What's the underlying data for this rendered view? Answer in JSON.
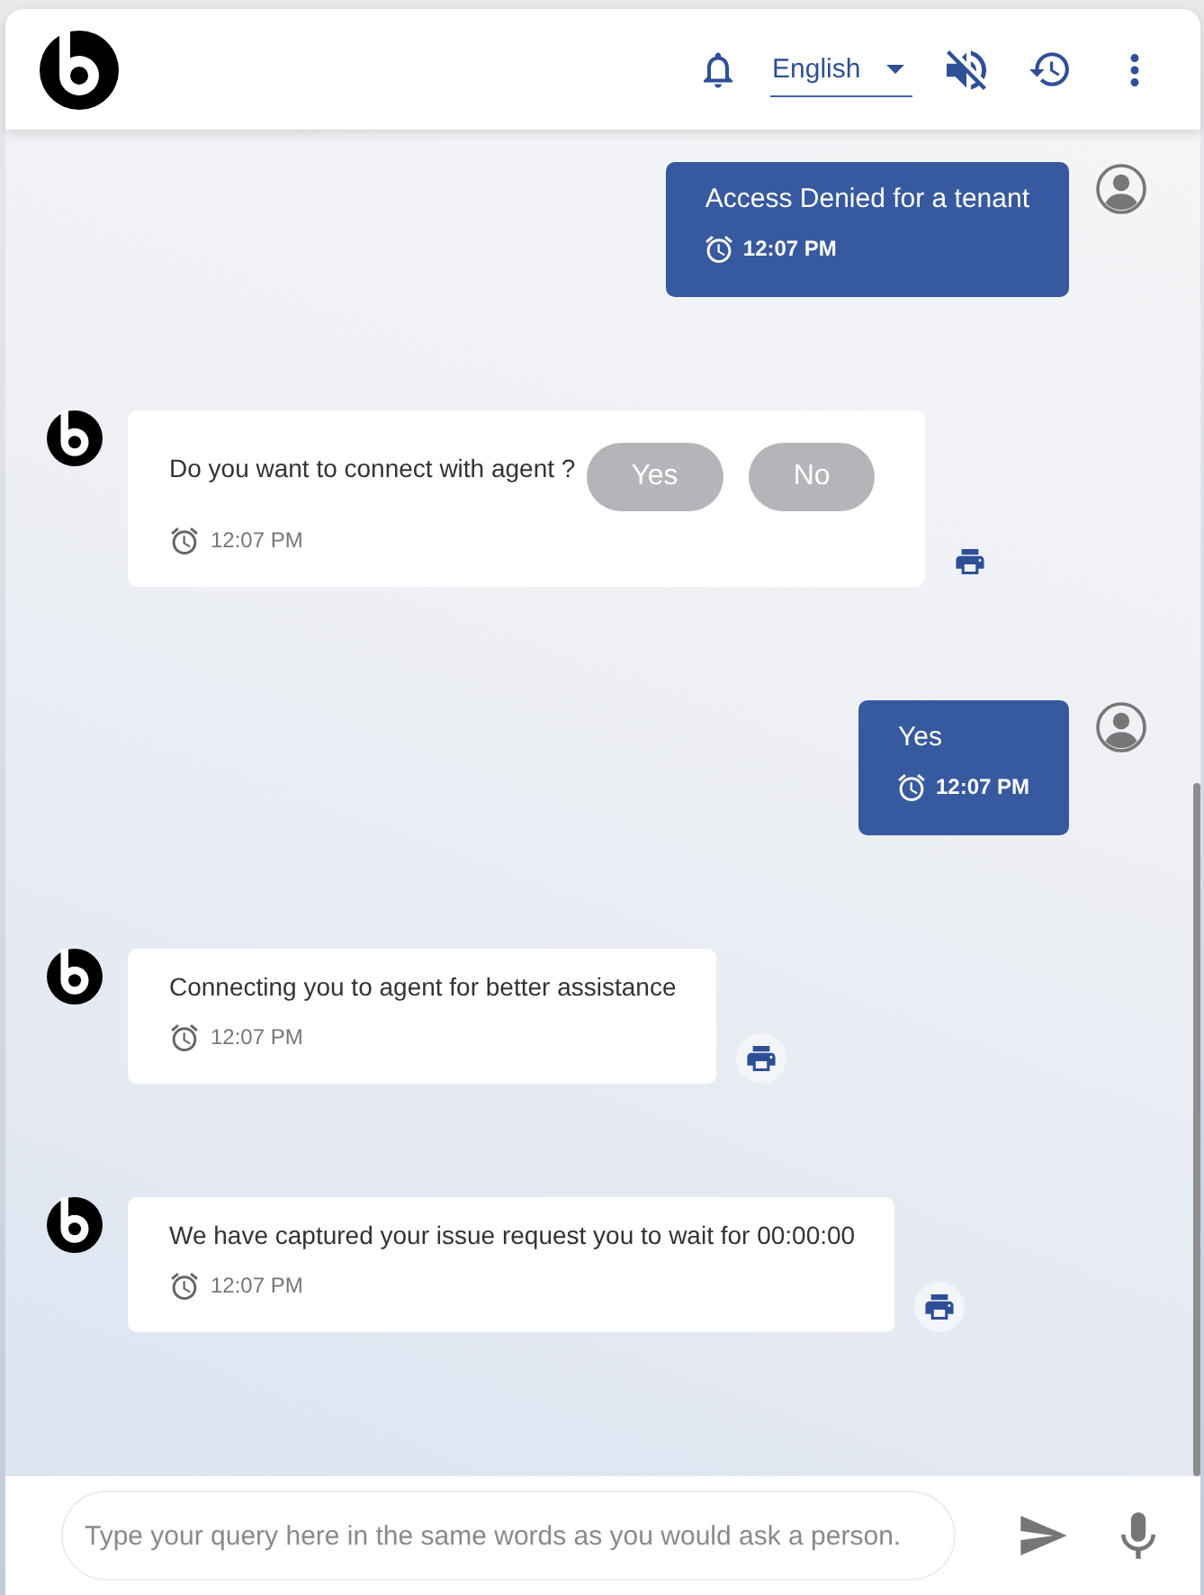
{
  "header": {
    "language": "English",
    "sound_muted": true
  },
  "messages": [
    {
      "kind": "user",
      "text": "Access Denied for a tenant",
      "time": "12:07 PM"
    },
    {
      "kind": "bot",
      "text": "Do you want to connect with agent ?",
      "time": "12:07 PM",
      "options": [
        {
          "label": "Yes",
          "disabled": true
        },
        {
          "label": "No",
          "disabled": true
        }
      ],
      "print_highlighted": false
    },
    {
      "kind": "user",
      "text": "Yes",
      "time": "12:07 PM"
    },
    {
      "kind": "bot",
      "text": "Connecting you to agent for better assistance",
      "time": "12:07 PM",
      "print_highlighted": true
    },
    {
      "kind": "bot",
      "text": "We have captured your issue request you to wait for 00:00:00",
      "time": "12:07 PM",
      "print_highlighted": true
    }
  ],
  "composer": {
    "placeholder": "Type your query here in the same words as you would ask a person."
  }
}
